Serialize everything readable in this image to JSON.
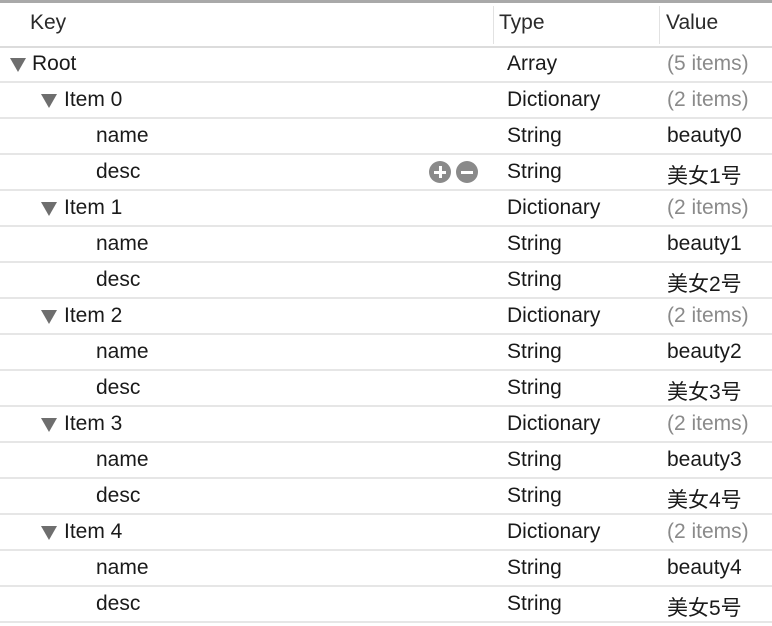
{
  "header": {
    "key": "Key",
    "type": "Type",
    "value": "Value"
  },
  "rows": [
    {
      "level": 0,
      "key": "Root",
      "type": "Array",
      "value": "(5 items)",
      "expanded": true,
      "muted": true
    },
    {
      "level": 1,
      "key": "Item 0",
      "type": "Dictionary",
      "value": "(2 items)",
      "expanded": true,
      "muted": true
    },
    {
      "level": 2,
      "key": "name",
      "type": "String",
      "value": "beauty0"
    },
    {
      "level": 2,
      "key": "desc",
      "type": "String",
      "value": "美女1号",
      "hover_buttons": true
    },
    {
      "level": 1,
      "key": "Item 1",
      "type": "Dictionary",
      "value": "(2 items)",
      "expanded": true,
      "muted": true
    },
    {
      "level": 2,
      "key": "name",
      "type": "String",
      "value": "beauty1"
    },
    {
      "level": 2,
      "key": "desc",
      "type": "String",
      "value": "美女2号"
    },
    {
      "level": 1,
      "key": "Item 2",
      "type": "Dictionary",
      "value": "(2 items)",
      "expanded": true,
      "muted": true
    },
    {
      "level": 2,
      "key": "name",
      "type": "String",
      "value": "beauty2"
    },
    {
      "level": 2,
      "key": "desc",
      "type": "String",
      "value": "美女3号"
    },
    {
      "level": 1,
      "key": "Item 3",
      "type": "Dictionary",
      "value": "(2 items)",
      "expanded": true,
      "muted": true
    },
    {
      "level": 2,
      "key": "name",
      "type": "String",
      "value": "beauty3"
    },
    {
      "level": 2,
      "key": "desc",
      "type": "String",
      "value": "美女4号"
    },
    {
      "level": 1,
      "key": "Item 4",
      "type": "Dictionary",
      "value": "(2 items)",
      "expanded": true,
      "muted": true
    },
    {
      "level": 2,
      "key": "name",
      "type": "String",
      "value": "beauty4"
    },
    {
      "level": 2,
      "key": "desc",
      "type": "String",
      "value": "美女5号"
    }
  ],
  "icons": {
    "expand": "disclosure-triangle-down-icon",
    "add": "plus-circle-icon",
    "remove": "minus-circle-icon"
  }
}
